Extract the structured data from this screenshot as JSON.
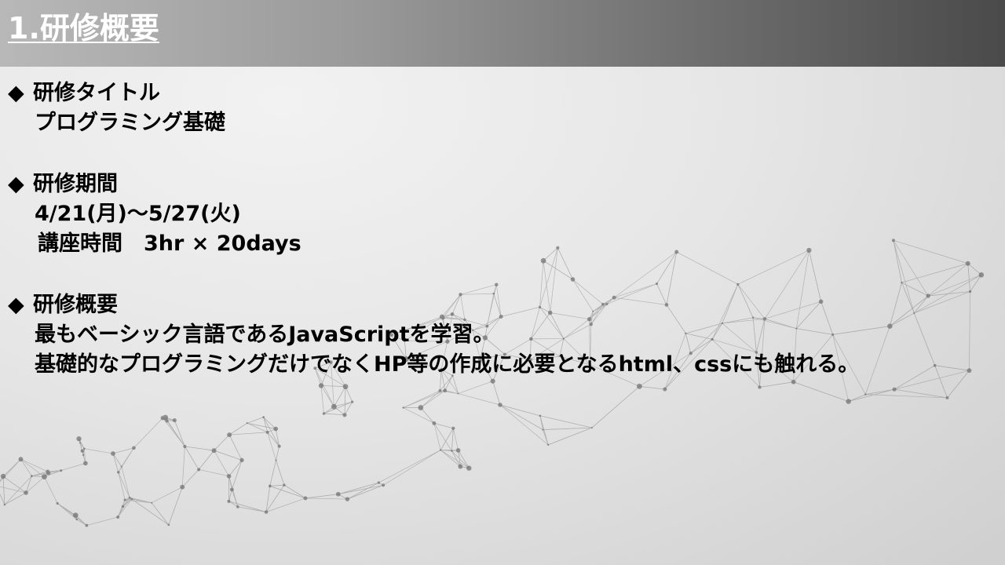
{
  "slide": {
    "title": "1.研修概要"
  },
  "sections": {
    "title_section": {
      "marker": "◆",
      "heading": "研修タイトル",
      "value": "プログラミング基礎"
    },
    "period_section": {
      "marker": "◆",
      "heading": "研修期間",
      "dates": "4/21(月)～5/27(火)",
      "hours": "講座時間　3hr × 20days"
    },
    "overview_section": {
      "marker": "◆",
      "heading": "研修概要",
      "line1": "最もベーシック言語であるJavaScriptを学習。",
      "line2": "基礎的なプログラミングだけでなくHP等の作成に必要となるhtml、cssにも触れる。"
    }
  },
  "colors": {
    "header_start": "#b8b8b8",
    "header_end": "#4a4a4a",
    "title_text": "#ffffff",
    "body_text": "#000000",
    "network_lines": "#8a8a8a"
  },
  "decorations": {
    "background": "network-mesh-graphic"
  }
}
